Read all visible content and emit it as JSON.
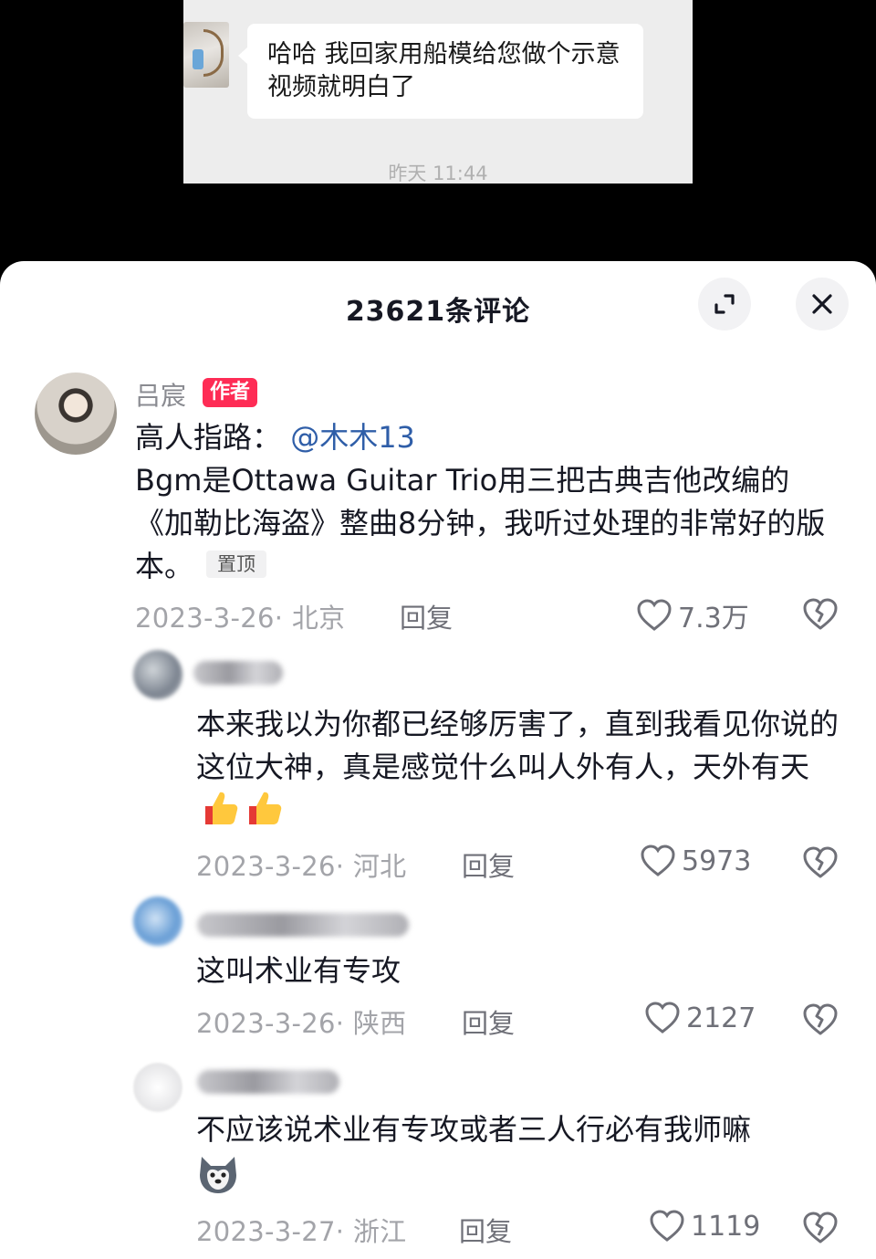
{
  "chat": {
    "message": "哈哈 我回家用船模给您做个示意视频就明白了",
    "time": "昨天 11:44"
  },
  "sheet": {
    "title": "23621条评论"
  },
  "comments": [
    {
      "user": "吕宸",
      "tag": "作者",
      "text_prefix": "高人指路：",
      "mention": "@木木13",
      "text": "Bgm是Ottawa Guitar Trio用三把古典吉他改编的《加勒比海盗》整曲8分钟，我听过处理的非常好的版本。",
      "pinned": "置顶",
      "meta": "2023-3-26· 北京",
      "reply": "回复",
      "likes": "7.3万"
    },
    {
      "text": "本来我以为你都已经够厉害了，直到我看见你说的这位大神，真是感觉什么叫人外有人，天外有天",
      "meta": "2023-3-26· 河北",
      "reply": "回复",
      "likes": "5973"
    },
    {
      "text": "这叫术业有专攻",
      "meta": "2023-3-26· 陕西",
      "reply": "回复",
      "likes": "2127"
    },
    {
      "text": "不应该说术业有专攻或者三人行必有我师嘛",
      "meta": "2023-3-27· 浙江",
      "reply": "回复",
      "likes": "1119"
    }
  ],
  "icons": {
    "expand": "expand-icon",
    "close": "close-icon",
    "like": "heart-icon",
    "dislike": "broken-heart-icon",
    "emoji_thumbs": "thumbs-up-emoji",
    "emoji_husky": "husky-emoji"
  },
  "colors": {
    "author_tag": "#fe2c55",
    "mention": "#2f5ea8"
  }
}
